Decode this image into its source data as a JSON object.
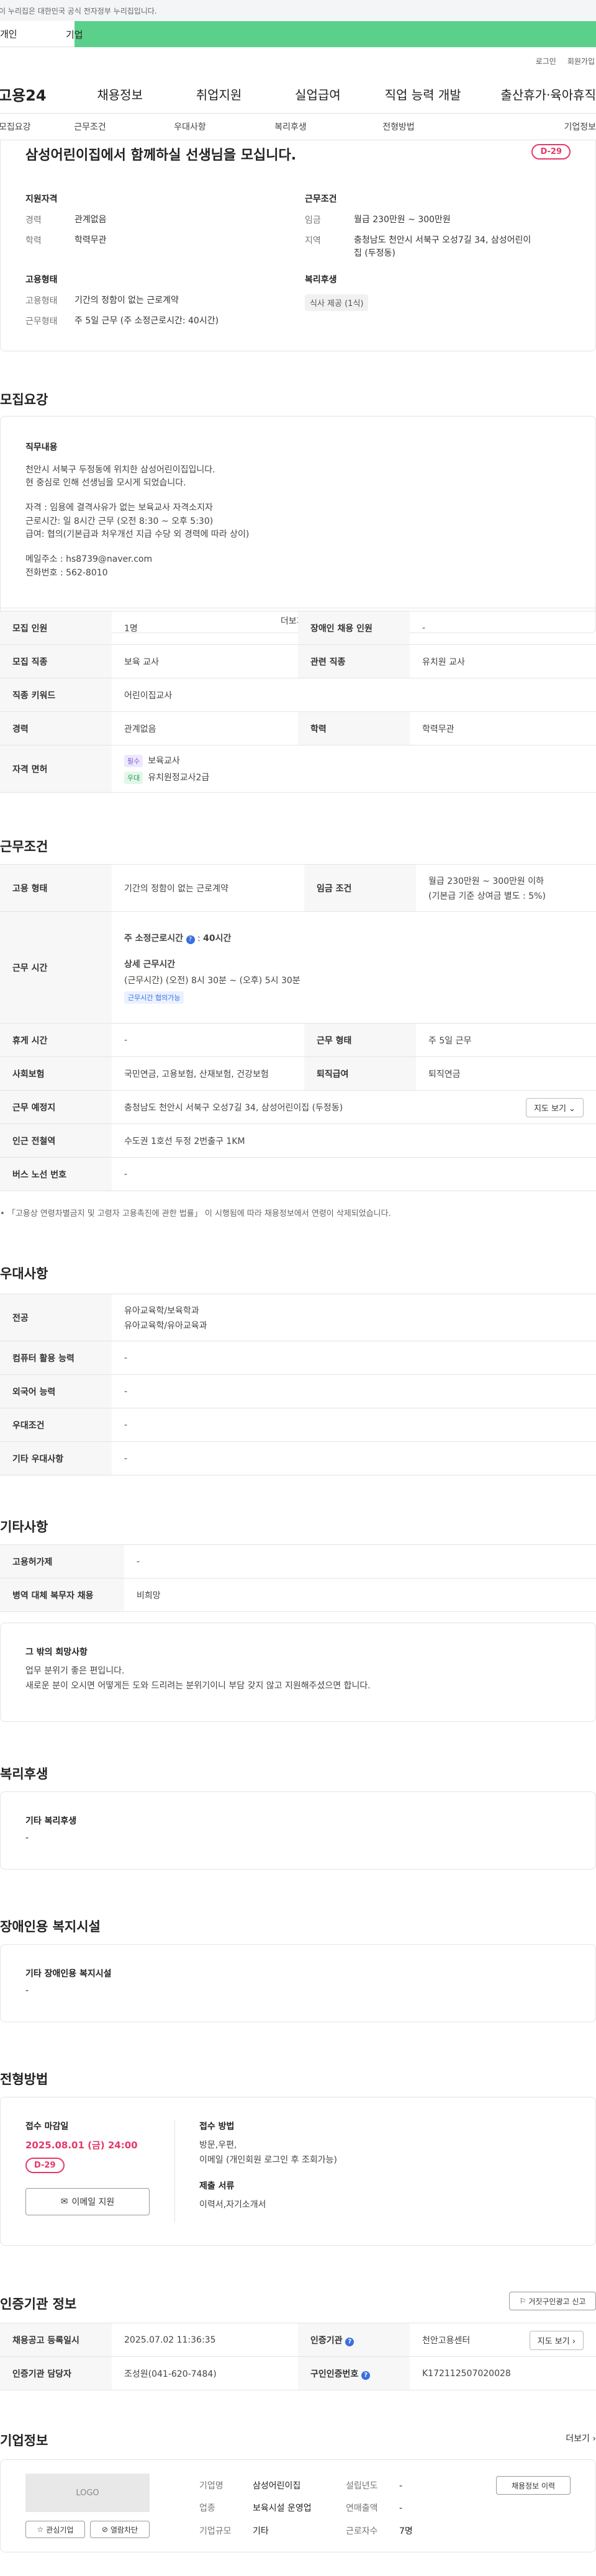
{
  "banner": {
    "text": "이 누리집은 대한민국 공식 전자정부 누리집입니다."
  },
  "service_tabs": {
    "personal": "개인",
    "company": "기업"
  },
  "util": {
    "login": "로그인",
    "join": "회원가입"
  },
  "gnb": {
    "logo": "고용24",
    "menu": [
      "채용정보",
      "취업지원",
      "실업급여",
      "직업 능력 개발",
      "출산휴가·육아휴직"
    ]
  },
  "subnav": [
    "모집요강",
    "근무조건",
    "우대사항",
    "복리후생",
    "전형방법",
    "기업정보"
  ],
  "summary": {
    "title": "삼성어린이집에서 함께하실 선생님을 모십니다.",
    "dday": "D-29",
    "qual": {
      "heading": "지원자격",
      "career_k": "경력",
      "career_v": "관계없음",
      "edu_k": "학력",
      "edu_v": "학력무관"
    },
    "work": {
      "heading": "근무조건",
      "wage_k": "임금",
      "wage_v": "월급 230만원 ~ 300만원",
      "loc_k": "지역",
      "loc_v": "충청남도 천안시 서북구 오성7길 34, 삼성어린이집 (두정동)"
    },
    "emp": {
      "heading": "고용형태",
      "type_k": "고용형태",
      "type_v": "기간의 정함이 없는 근로계약",
      "hours_k": "근무형태",
      "hours_v": "주 5일 근무 (주 소정근로시간: 40시간)"
    },
    "welfare": {
      "heading": "복리후생",
      "chip": "식사 제공 (1식)"
    }
  },
  "recruit": {
    "heading": "모집요강",
    "content_title": "직무내용",
    "lines": [
      "천안시 서북구 두정동에 위치한 삼성어린이집입니다.",
      "현 중심로 인해 선생님을 모시게 되었습니다.",
      "",
      "자격 : 임용에 결격사유가 없는 보육교사 자격소지자",
      "근로시간: 일 8시간 근무 (오전 8:30 ~ 오후 5:30)",
      "급여: 협의(기본급과 처우개선 지급 수당 외 경력에 따라 상이)",
      "",
      "메일주소 : hs8739@naver.com",
      "전화번호 : 562-8010"
    ],
    "more": "더보기"
  },
  "recruit_table": {
    "count_k": "모집 인원",
    "count_v": "1명",
    "disab_k": "장애인 채용 인원",
    "disab_v": "-",
    "job_k": "모집 직종",
    "job_v": "보육 교사",
    "rel_k": "관련 직종",
    "rel_v": "유치원 교사",
    "kw_k": "직종 키워드",
    "kw_v": "어린이집교사",
    "career_k": "경력",
    "career_v": "관계없음",
    "edu_k": "학력",
    "edu_v": "학력무관",
    "lic_k": "자격 면허",
    "lic": [
      {
        "tag": "필수",
        "name": "보육교사"
      },
      {
        "tag": "우대",
        "name": "유치원정교사2급"
      }
    ]
  },
  "condition": {
    "heading": "근무조건",
    "emptype_k": "고용 형태",
    "emptype_v": "기간의 정함이 없는 근로계약",
    "wage_k": "임금 조건",
    "wage_v1": "월급 230만원 ~ 300만원 이하",
    "wage_v2": "(기본급 기준 상여금 별도 : 5%)",
    "hours_k": "근무 시간",
    "weekly": "주 소정근로시간",
    "weekly_v": "40시간",
    "detail_title": "상세 근무시간",
    "detail_v": "(근무시간) (오전) 8시 30분 ~ (오후) 5시 30분",
    "flex": "근무시간 협의가능",
    "rest_k": "휴게 시간",
    "rest_v": "-",
    "form_k": "근무 형태",
    "form_v": "주 5일 근무",
    "ins_k": "사회보험",
    "ins_v": "국민연금, 고용보험, 산재보험, 건강보험",
    "retire_k": "퇴직급여",
    "retire_v": "퇴직연금",
    "place_k": "근무 예정지",
    "place_v": "충청남도 천안시 서북구 오성7길 34, 삼성어린이집 (두정동)",
    "map": "지도 보기",
    "subway_k": "인근 전철역",
    "subway_v": "수도권 1호선 두정 2번출구 1KM",
    "bus_k": "버스 노선 번호",
    "bus_v": "-",
    "note": "「고용상 연령차별금지 및 고령자 고용촉진에 관한 법률」 이 시행됨에 따라 채용정보에서 연령이 삭제되었습니다."
  },
  "prefer": {
    "heading": "우대사항",
    "major_k": "전공",
    "major_v1": "유아교육학/보육학과",
    "major_v2": "유아교육학/유아교육과",
    "pc_k": "컴퓨터 활용 능력",
    "pc_v": "-",
    "lang_k": "외국어 능력",
    "lang_v": "-",
    "cond_k": "우대조건",
    "cond_v": "-",
    "etc_k": "기타 우대사항",
    "etc_v": "-"
  },
  "etc": {
    "heading": "기타사항",
    "type_k": "고용허가제",
    "type_v": "-",
    "mil_k": "병역 대체 복무자 채용",
    "mil_v": "비희망",
    "hope_title": "그 밖의 희망사항",
    "hope1": "업무 분위기 좋은 편입니다.",
    "hope2": "새로운 분이 오시면 어떻게든 도와 드리려는 분위기이니 부담 갖지 않고 지원해주셨으면 합니다."
  },
  "welfare": {
    "heading": "복리후생",
    "title": "기타 복리후생",
    "value": "-"
  },
  "disability": {
    "heading": "장애인용 복지시설",
    "title": "기타 장애인용 복지시설",
    "value": "-"
  },
  "process": {
    "heading": "전형방법",
    "deadline_title": "접수 마감일",
    "deadline": "2025.08.01 (금) 24:00",
    "dday": "D-29",
    "mail_btn": "이메일 지원",
    "method_title": "접수 방법",
    "method_v1": "방문,우편,",
    "method_v2": "이메일 (개인회원 로그인 후 조회가능)",
    "docs_title": "제출 서류",
    "docs_v": "이력서,자기소개서"
  },
  "agency": {
    "heading": "인증기관 정보",
    "report": "거짓구인광고 신고",
    "reg_k": "채용공고 등록일시",
    "reg_v": "2025.07.02 11:36:35",
    "org_k": "인증기관",
    "org_v": "천안고용센터",
    "map": "지도 보기",
    "mgr_k": "인증기관 담당자",
    "mgr_v": "조성원(041-620-7484)",
    "num_k": "구인인증번호",
    "num_v": "K172112507020028"
  },
  "company": {
    "heading": "기업정보",
    "more": "더보기",
    "logo": "LOGO",
    "fav": "관심기업",
    "block": "열람차단",
    "name_k": "기업명",
    "name_v": "삼성어린이집",
    "year_k": "설립년도",
    "year_v": "-",
    "biz_k": "업종",
    "biz_v": "보육시설 운영업",
    "sales_k": "연매출액",
    "sales_v": "-",
    "size_k": "기업규모",
    "size_v": "기타",
    "emp_k": "근로자수",
    "emp_v": "7명",
    "jobs_btn": "채용정보 이력"
  }
}
